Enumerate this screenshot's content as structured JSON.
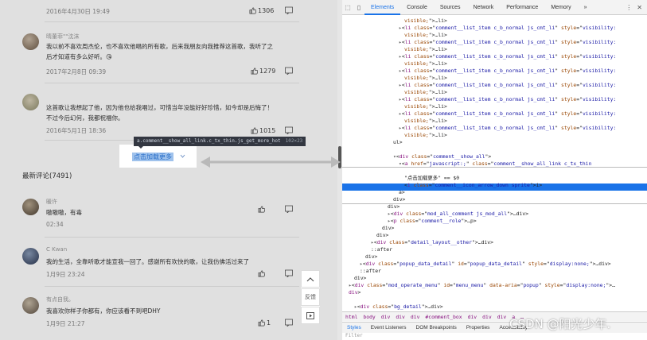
{
  "page": {
    "comments": [
      {
        "name": "",
        "text": [],
        "time": "2016年4月30日 19:49",
        "likes": "1306",
        "has_avatar": false
      },
      {
        "name": "晴董菲\"\"沈沫",
        "text": [
          "我以前不喜欢周杰伦，也不喜欢他唱的所有歌，后来我朋友向我推荐这首歌，我听了之",
          "后才知道有多么好听。😘"
        ],
        "time": "2017年2月8日 09:39",
        "likes": "1279",
        "has_avatar": true
      },
      {
        "name": "",
        "text": [
          "这首歌让我想起了他，因为他也给我唱过，可惜当年没能好好珍惜，如今却是后悔了！",
          "不过今后幻何，我都祝福你。"
        ],
        "time": "2016年5月1日 18:36",
        "likes": "1015",
        "has_avatar": true
      }
    ],
    "show_more": "点击加载更多",
    "tooltip": {
      "selector": "a.comment__show_all_link.c_tx_thin.js_get_more_hot",
      "size": "102×23"
    },
    "section_title": "最新评论(7491)",
    "latest": [
      {
        "name": "暖许",
        "text": "嗷嗷嗷，有毒",
        "time": "02:34"
      },
      {
        "name": "C Kwan",
        "text": "我的生活，全靠听歌才能宣我一回了。感谢所有欢快的歌，让我仿佛活过来了",
        "time": "1月9日 23:24"
      },
      {
        "name": "有点自我。",
        "text": "我喜欢你样子你都有，你应该看不到吧DHY",
        "time": "1月9日 21:27",
        "likes": "1"
      }
    ],
    "float_bar": {
      "feedback": "反馈"
    }
  },
  "devtools": {
    "tabs": [
      "Elements",
      "Console",
      "Sources",
      "Network",
      "Performance",
      "Memory",
      "»"
    ],
    "active_tab": "Elements",
    "code_lines": [
      {
        "indent": 2,
        "html": "<span class=\"at\">visible;</span>\">…</<span class=\"tg\">li</span>>"
      },
      {
        "indent": 1,
        "html": "<span class=\"tri\">▸</span><<span class=\"tg\">li</span> <span class=\"at\">class</span>=\"<span class=\"av\">comment__list_item c_b_normal js_cmt_li</span>\" <span class=\"at\">style</span>=\"<span class=\"av\">visibility:</span>"
      },
      {
        "indent": 2,
        "html": "<span class=\"at\">visible;</span>\">…</<span class=\"tg\">li</span>>"
      },
      {
        "indent": 1,
        "html": "<span class=\"tri\">▸</span><<span class=\"tg\">li</span> <span class=\"at\">class</span>=\"<span class=\"av\">comment__list_item c_b_normal js_cmt_li</span>\" <span class=\"at\">style</span>=\"<span class=\"av\">visibility:</span>"
      },
      {
        "indent": 2,
        "html": "<span class=\"at\">visible;</span>\">…</<span class=\"tg\">li</span>>"
      },
      {
        "indent": 1,
        "html": "<span class=\"tri\">▸</span><<span class=\"tg\">li</span> <span class=\"at\">class</span>=\"<span class=\"av\">comment__list_item c_b_normal js_cmt_li</span>\" <span class=\"at\">style</span>=\"<span class=\"av\">visibility:</span>"
      },
      {
        "indent": 2,
        "html": "<span class=\"at\">visible;</span>\">…</<span class=\"tg\">li</span>>"
      },
      {
        "indent": 1,
        "html": "<span class=\"tri\">▸</span><<span class=\"tg\">li</span> <span class=\"at\">class</span>=\"<span class=\"av\">comment__list_item c_b_normal js_cmt_li</span>\" <span class=\"at\">style</span>=\"<span class=\"av\">visibility:</span>"
      },
      {
        "indent": 2,
        "html": "<span class=\"at\">visible;</span>\">…</<span class=\"tg\">li</span>>"
      },
      {
        "indent": 1,
        "html": "<span class=\"tri\">▸</span><<span class=\"tg\">li</span> <span class=\"at\">class</span>=\"<span class=\"av\">comment__list_item c_b_normal js_cmt_li</span>\" <span class=\"at\">style</span>=\"<span class=\"av\">visibility:</span>"
      },
      {
        "indent": 2,
        "html": "<span class=\"at\">visible;</span>\">…</<span class=\"tg\">li</span>>"
      },
      {
        "indent": 1,
        "html": "<span class=\"tri\">▸</span><<span class=\"tg\">li</span> <span class=\"at\">class</span>=\"<span class=\"av\">comment__list_item c_b_normal js_cmt_li</span>\" <span class=\"at\">style</span>=\"<span class=\"av\">visibility:</span>"
      },
      {
        "indent": 2,
        "html": "<span class=\"at\">visible;</span>\">…</<span class=\"tg\">li</span>>"
      },
      {
        "indent": 1,
        "html": "<span class=\"tri\">▸</span><<span class=\"tg\">li</span> <span class=\"at\">class</span>=\"<span class=\"av\">comment__list_item c_b_normal js_cmt_li</span>\" <span class=\"at\">style</span>=\"<span class=\"av\">visibility:</span>"
      },
      {
        "indent": 2,
        "html": "<span class=\"at\">visible;</span>\">…</<span class=\"tg\">li</span>>"
      },
      {
        "indent": 1,
        "html": "<span class=\"tri\">▸</span><<span class=\"tg\">li</span> <span class=\"at\">class</span>=\"<span class=\"av\">comment__list_item c_b_normal js_cmt_li</span>\" <span class=\"at\">style</span>=\"<span class=\"av\">visibility:</span>"
      },
      {
        "indent": 2,
        "html": "<span class=\"at\">visible;</span>\">…</<span class=\"tg\">li</span>>"
      },
      {
        "indent": 0,
        "html": "</<span class=\"tg\">ul</span>>"
      },
      {
        "indent": 0,
        "html": "<span class=\"cm\"><!-- 展开热评comment__show_all--on --></span>"
      },
      {
        "indent": 0,
        "html": "<span class=\"tri\">▾</span><<span class=\"tg\">div</span> <span class=\"at\">class</span>=\"<span class=\"av\">comment__show_all</span>\">"
      },
      {
        "indent": 1,
        "html": "<span class=\"tri\">▾</span><<span class=\"tg\">a</span> <span class=\"at\">href</span>=\"<span class=\"av\">javascript:;</span>\" <span class=\"at\">class</span>=\"<span class=\"av\">comment__show_all_link c_tx_thin</span>"
      },
      {
        "indent": 1,
        "html": "<span class=\"av\">js_get_more_hot</span>\" <span class=\"at\">style</span>>"
      },
      {
        "indent": 2,
        "html": "\"点击加载更多\" == $0"
      },
      {
        "indent": 2,
        "html": "<<span class=\"tg\">i</span> <span class=\"at\">class</span>=\"<span class=\"av\">comment__icon_arrow_down sprite</span>\"></<span class=\"tg\">i</span>>"
      },
      {
        "indent": 1,
        "html": "</<span class=\"tg\">a</span>>"
      },
      {
        "indent": 0,
        "html": "</<span class=\"tg\">div</span>>"
      },
      {
        "indent": -1,
        "html": "</<span class=\"tg\">div</span>>"
      },
      {
        "indent": -1,
        "html": "<span class=\"tri\">▸</span><<span class=\"tg\">div</span> <span class=\"at\">class</span>=\"<span class=\"av\">mod_all_comment js_mod_all</span>\">…</<span class=\"tg\">div</span>>"
      },
      {
        "indent": -1,
        "html": "<span class=\"tri\">▸</span><<span class=\"tg\">p</span> <span class=\"at\">class</span>=\"<span class=\"av\">comment__role</span>\">…</<span class=\"tg\">p</span>>"
      },
      {
        "indent": -2,
        "html": "</<span class=\"tg\">div</span>>"
      },
      {
        "indent": -3,
        "html": "</<span class=\"tg\">div</span>>"
      },
      {
        "indent": -4,
        "html": "<span class=\"tri\">▸</span><<span class=\"tg\">div</span> <span class=\"at\">class</span>=\"<span class=\"av\">detail_layout__other</span>\">…</<span class=\"tg\">div</span>>"
      },
      {
        "indent": -4,
        "html": "::after"
      },
      {
        "indent": -5,
        "html": "</<span class=\"tg\">div</span>>"
      },
      {
        "indent": -6,
        "html": "<span class=\"tri\">▸</span><<span class=\"tg\">div</span> <span class=\"at\">class</span>=\"<span class=\"av\">popup_data_detail</span>\" <span class=\"at\">id</span>=\"<span class=\"av\">popup_data_detail</span>\" <span class=\"at\">style</span>=\"<span class=\"av\">display:none;</span>\">…</<span class=\"tg\">div</span>>"
      },
      {
        "indent": -6,
        "html": "::after"
      },
      {
        "indent": -7,
        "html": "</<span class=\"tg\">div</span>>"
      },
      {
        "indent": -8,
        "html": "<span class=\"tri\">▸</span><<span class=\"tg\">div</span> <span class=\"at\">class</span>=\"<span class=\"av\">mod_operate_menu</span>\" <span class=\"at\">id</span>=\"<span class=\"av\">menu_menu</span>\" <span class=\"at\">data-aria</span>=\"<span class=\"av\">popup</span>\" <span class=\"at\">style</span>=\"<span class=\"av\">display:none;</span>\">…"
      },
      {
        "indent": -8,
        "html": "<span class=\"tg\">div</span>>"
      },
      {
        "indent": -7,
        "html": "<span class=\"cm\"><!-- 固头底部一致 --></span>"
      },
      {
        "indent": -7,
        "html": "<span class=\"tri\">▸</span><<span class=\"tg\">div</span> <span class=\"at\">class</span>=\"<span class=\"av\">bg_detail</span>\">…</<span class=\"tg\">div</span>>"
      }
    ],
    "breadcrumb": [
      "html",
      "body",
      "div",
      "div",
      "div",
      "#comment_box",
      "div",
      "div",
      "div",
      "a",
      "…"
    ],
    "bottom_tabs": [
      "Styles",
      "Event Listeners",
      "DOM Breakpoints",
      "Properties",
      "Accessibility"
    ],
    "filter_placeholder": "Filter"
  },
  "watermark": "CSDN @阳光少年."
}
